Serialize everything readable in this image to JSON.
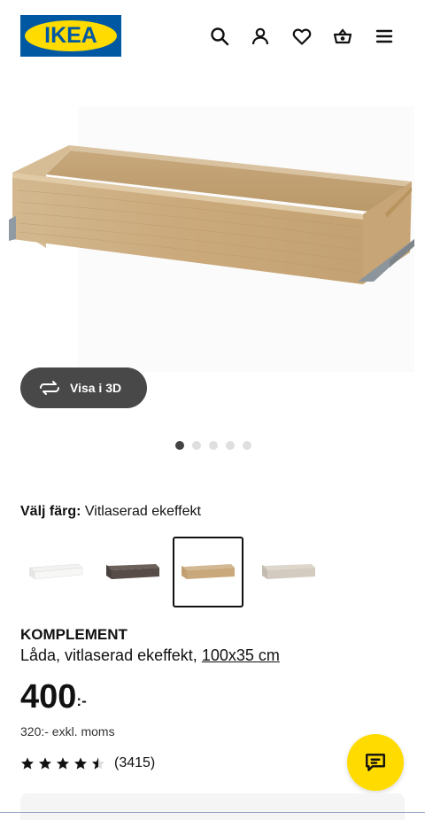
{
  "header": {
    "logo_text": "IKEA",
    "icons": [
      "search-icon",
      "user-icon",
      "heart-icon",
      "basket-icon",
      "menu-icon"
    ]
  },
  "gallery": {
    "view_3d_label": "Visa i 3D",
    "dots_count": 5,
    "active_dot": 0
  },
  "color": {
    "label": "Välj färg:",
    "value": "Vitlaserad ekeffekt",
    "swatches": [
      {
        "name": "white",
        "color": "#f2f2f0",
        "selected": false
      },
      {
        "name": "dark-brown",
        "color": "#5a4f4a",
        "selected": false
      },
      {
        "name": "oak",
        "color": "#c9a97c",
        "selected": true
      },
      {
        "name": "beige",
        "color": "#cfc7bb",
        "selected": false
      }
    ]
  },
  "product": {
    "name": "KOMPLEMENT",
    "description": "Låda, vitlaserad ekeffekt,",
    "size_link": "100x35 cm"
  },
  "price": {
    "amount": "400",
    "suffix": ":-",
    "ex_vat": "320:- exkl. moms"
  },
  "rating": {
    "stars": 4.5,
    "count": "(3415)"
  },
  "colors": {
    "brand_blue": "#0058a3",
    "brand_yellow": "#ffdb00",
    "button_dark": "#484848"
  }
}
